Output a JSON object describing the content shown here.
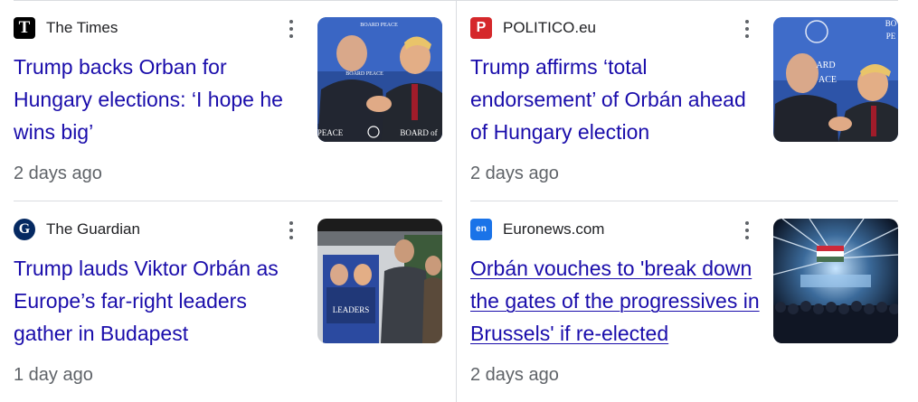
{
  "articles": [
    {
      "source": "The Times",
      "favicon_glyph": "T",
      "favicon_icon": "the-times-logo",
      "headline": "Trump backs Orban for Hungary elections: ‘I hope he wins big’",
      "time": "2 days ago",
      "thumbnail_overlay": [
        "BOARD PEACE",
        "BOARD PEACE",
        "PEACE",
        "BOARD of"
      ]
    },
    {
      "source": "POLITICO.eu",
      "favicon_glyph": "P",
      "favicon_icon": "politico-logo",
      "headline": "Trump affirms ‘total endorsement’ of Orbán ahead of Hungary election",
      "time": "2 days ago",
      "thumbnail_overlay": [
        "ARD",
        "ACE",
        "BO",
        "PE"
      ]
    },
    {
      "source": "The Guardian",
      "favicon_glyph": "G",
      "favicon_icon": "the-guardian-logo",
      "headline": "Trump lauds Viktor Orbán as Europe’s far-right leaders gather in Budapest",
      "time": "1 day ago",
      "thumbnail_overlay": [
        "LEADERS"
      ]
    },
    {
      "source": "Euronews.com",
      "favicon_glyph": "en",
      "favicon_icon": "euronews-logo",
      "headline": "Orbán vouches to 'break down the gates of the progressives in Brussels' if re-elected",
      "time": "2 days ago",
      "thumbnail_overlay": []
    }
  ],
  "colors": {
    "link": "#1a0dab",
    "meta": "#5f6368",
    "source": "#202124",
    "divider": "#dadce0",
    "politico": "#d5282b",
    "euronews": "#1a73e8",
    "guardian": "#052962"
  },
  "icons": {
    "more": "more-vert-icon"
  }
}
